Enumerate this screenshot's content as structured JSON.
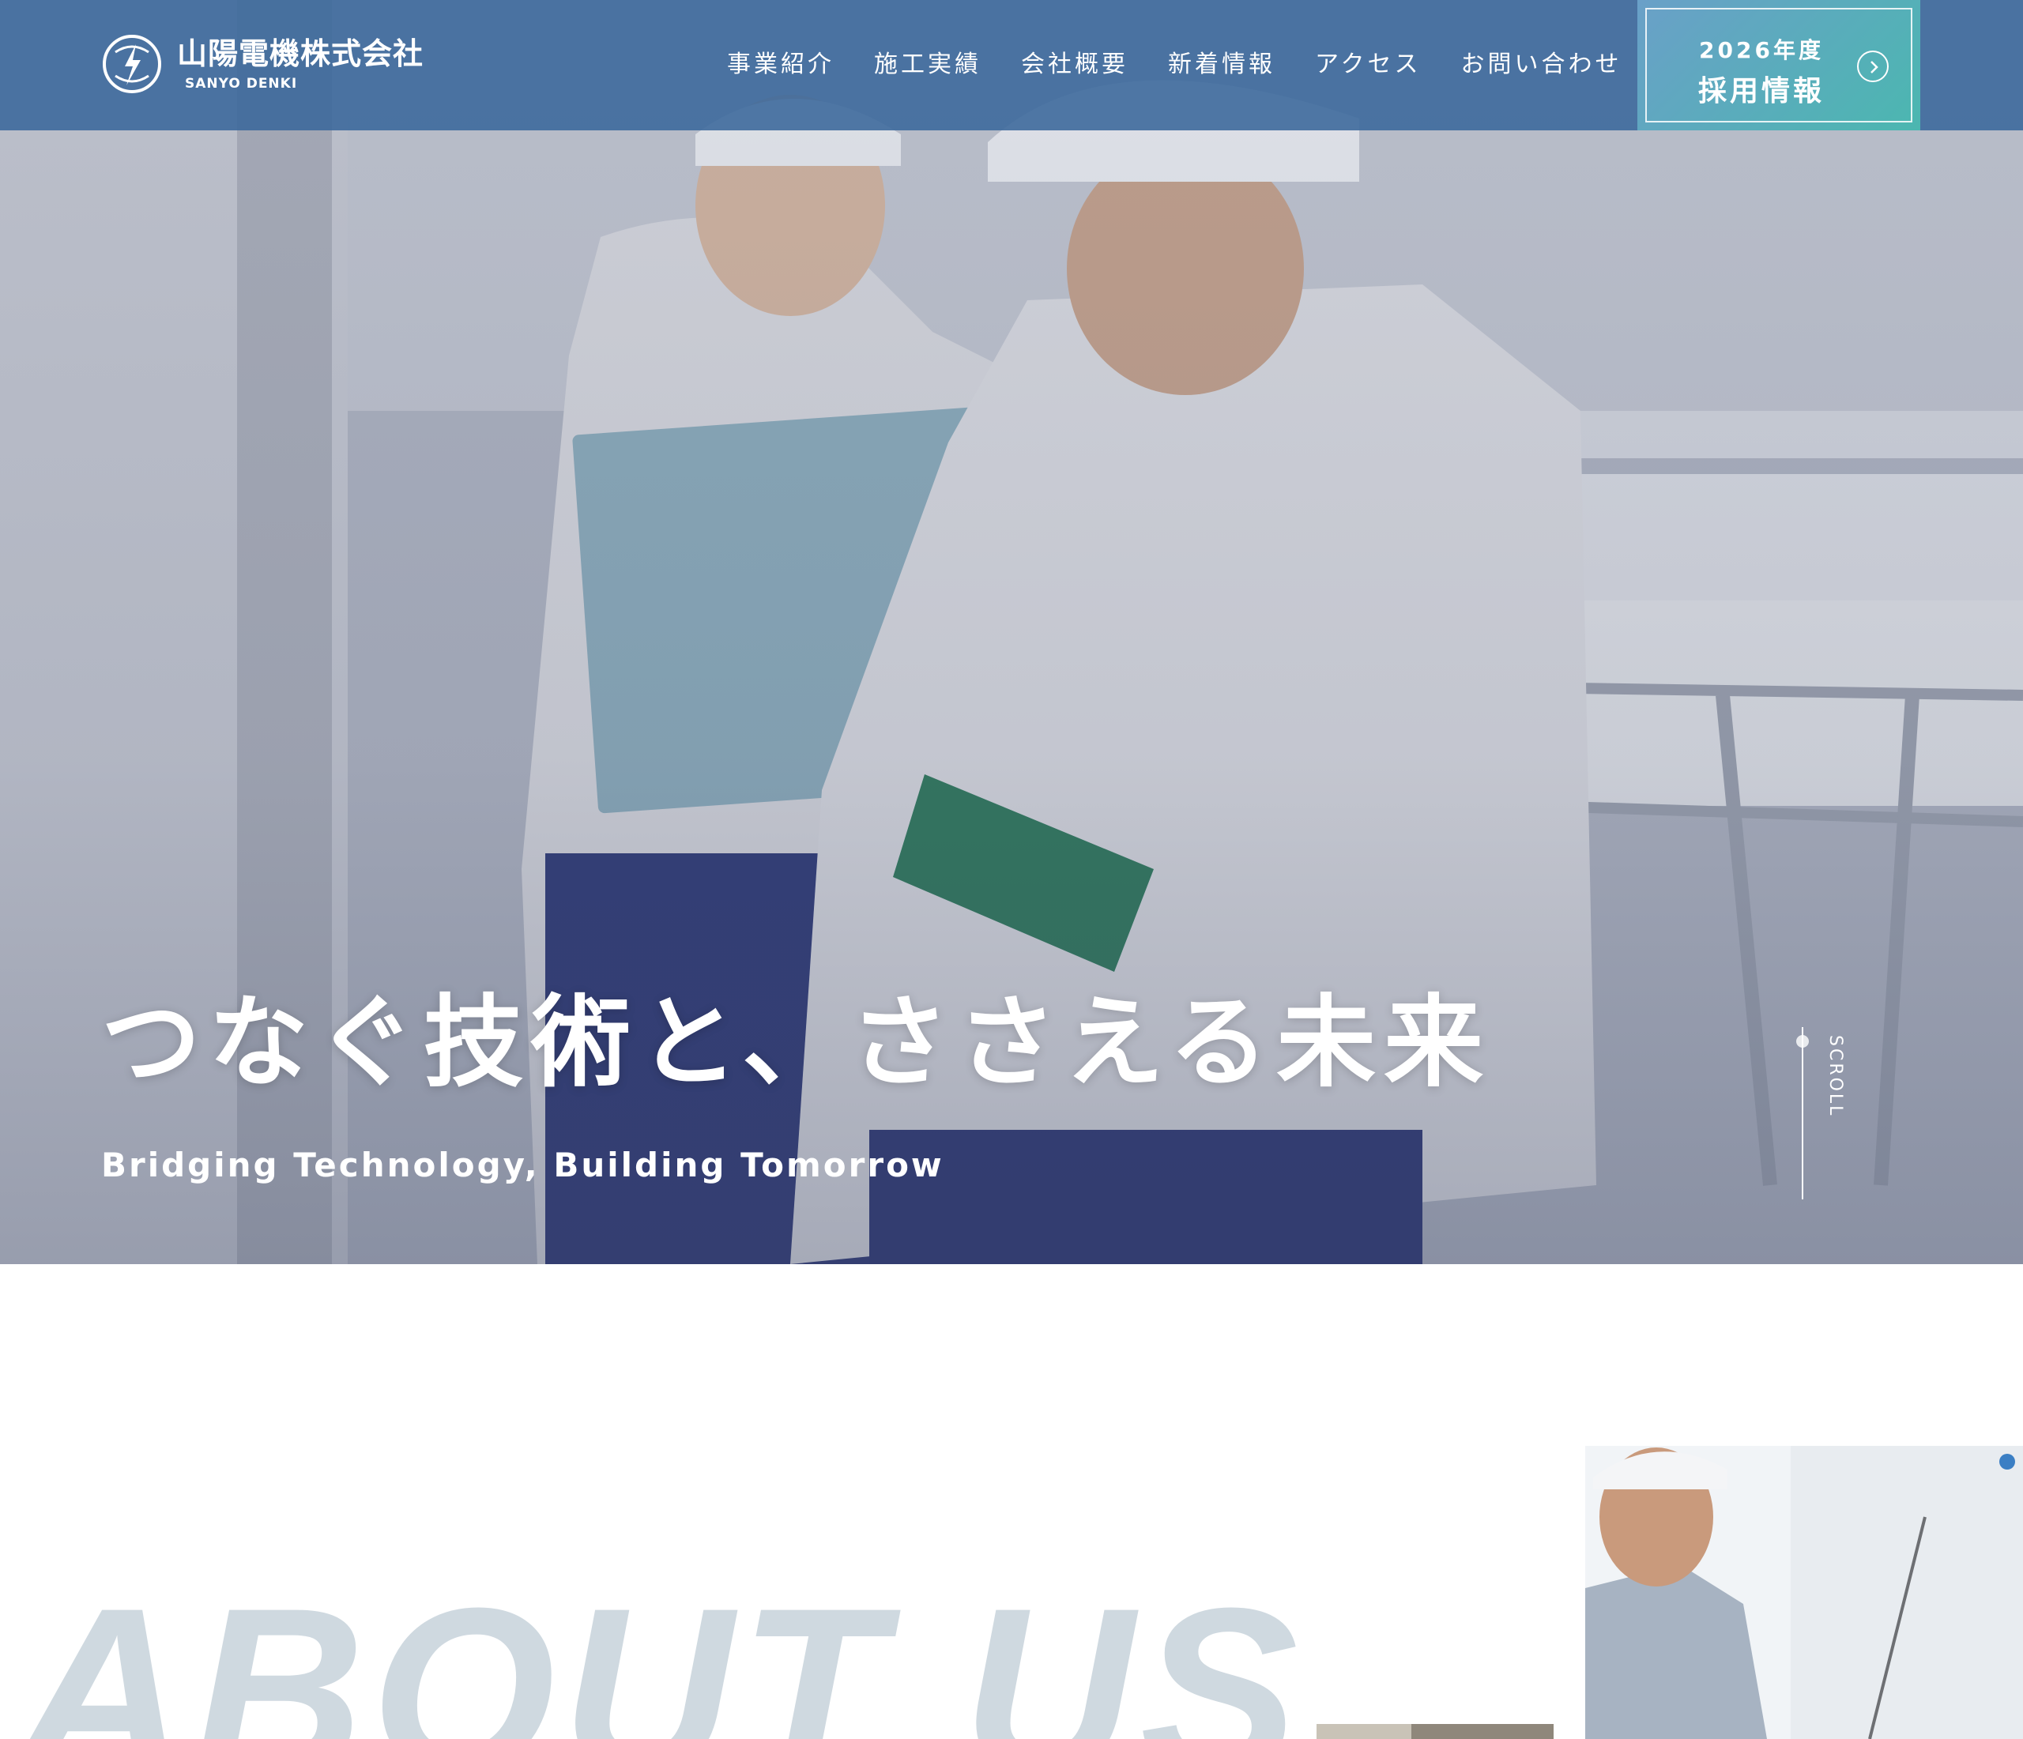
{
  "header": {
    "logo": {
      "name_jp": "山陽電機株式会社",
      "name_en": "SANYO DENKI"
    },
    "nav": [
      {
        "label": "事業紹介"
      },
      {
        "label": "施工実績"
      },
      {
        "label": "会社概要"
      },
      {
        "label": "新着情報"
      },
      {
        "label": "アクセス"
      },
      {
        "label": "お問い合わせ"
      }
    ],
    "recruit": {
      "year": "2026年度",
      "label": "採用情報"
    }
  },
  "hero": {
    "title": "つなぐ技術と、ささえる未来",
    "subtitle": "Bridging Technology, Building Tomorrow",
    "scroll": "SCROLL"
  },
  "about": {
    "bg_text": "ABOUT US"
  },
  "colors": {
    "header_bg": "#3a689b",
    "recruit_gradient_start": "#6aa0c8",
    "recruit_gradient_end": "#4bb7b0",
    "about_bg_text": "#cfd9e0"
  }
}
